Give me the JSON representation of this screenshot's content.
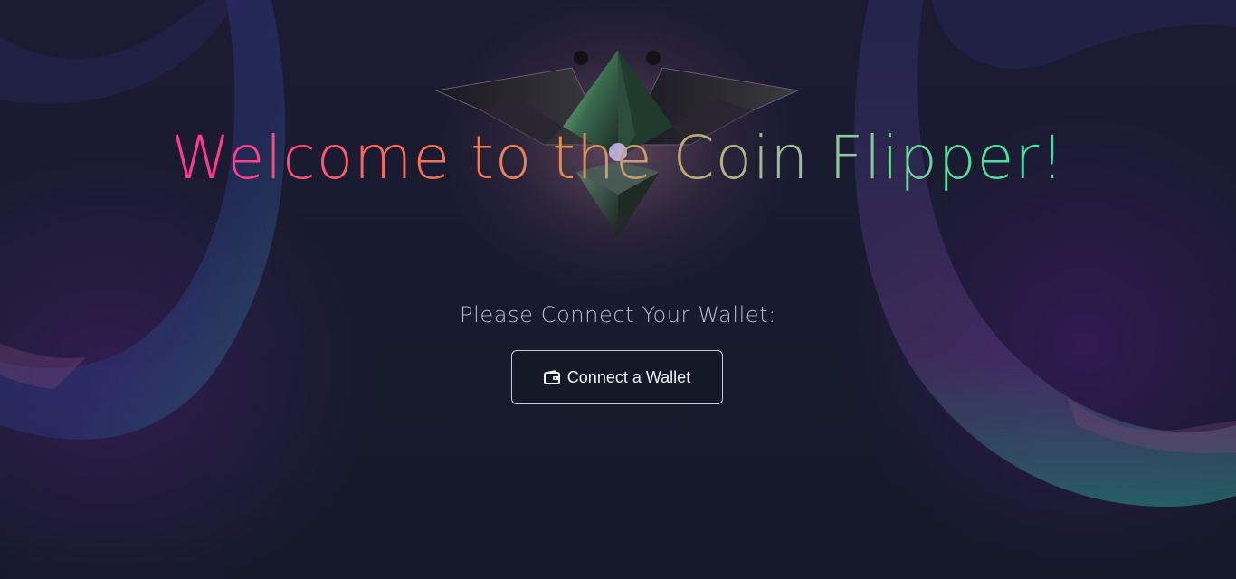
{
  "page": {
    "title": "Welcome to the Coin Flipper!",
    "prompt": "Please Connect Your Wallet:"
  },
  "connect_button": {
    "label": "Connect a Wallet",
    "icon": "wallet-icon"
  },
  "logo": {
    "icon": "ethereum-diamond-logo"
  },
  "colors": {
    "background": "#151a2a",
    "title_gradient_start": "#ff2bc2",
    "title_gradient_mid": "#ff6a55",
    "title_gradient_end": "#1ff3a8",
    "prompt_text": "#b9bccd",
    "button_border": "#c9ccd8",
    "button_text": "#f2f3f8"
  }
}
